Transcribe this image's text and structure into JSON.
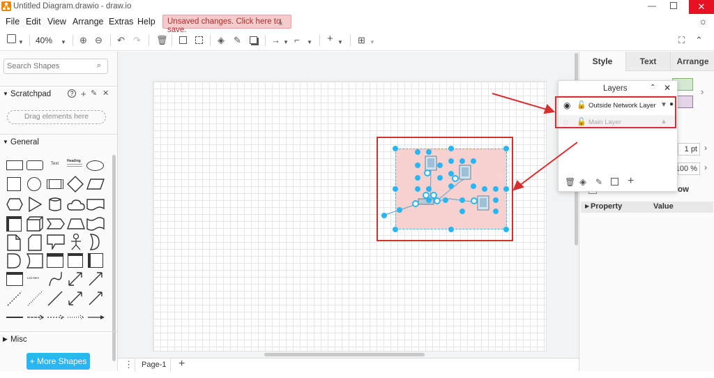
{
  "window": {
    "title": "Untitled Diagram.drawio - draw.io"
  },
  "menu": {
    "items": [
      "File",
      "Edit",
      "View",
      "Arrange",
      "Extras",
      "Help"
    ],
    "unsaved_banner": "Unsaved changes. Click here to save."
  },
  "toolbar": {
    "zoom": "40%"
  },
  "left_panel": {
    "search_placeholder": "Search Shapes",
    "scratchpad_title": "Scratchpad",
    "scratchpad_drop": "Drag elements here",
    "general_title": "General",
    "misc_title": "Misc",
    "more_shapes": "+ More Shapes",
    "shape_text_label": "Text",
    "shape_heading_label": "Heading",
    "shape_list_label": "List Item"
  },
  "right_panel": {
    "tabs": [
      "Style",
      "Text",
      "Arrange"
    ],
    "line_width": "1 pt",
    "opacity": "100 %",
    "shadow_label": "ow",
    "property_header": "Property",
    "value_header": "Value"
  },
  "layers_dialog": {
    "title": "Layers",
    "layers": [
      {
        "name": "Outside Network Layer",
        "visible": true,
        "active": true
      },
      {
        "name": "Main Layer",
        "visible": false,
        "active": false
      }
    ]
  },
  "page_bar": {
    "page_name": "Page-1"
  },
  "colors": {
    "accent": "#29b6f2",
    "selection_fill": "#f8cecc",
    "annotation_red": "#d62f2f",
    "unsaved_bg": "#f4cccc"
  }
}
